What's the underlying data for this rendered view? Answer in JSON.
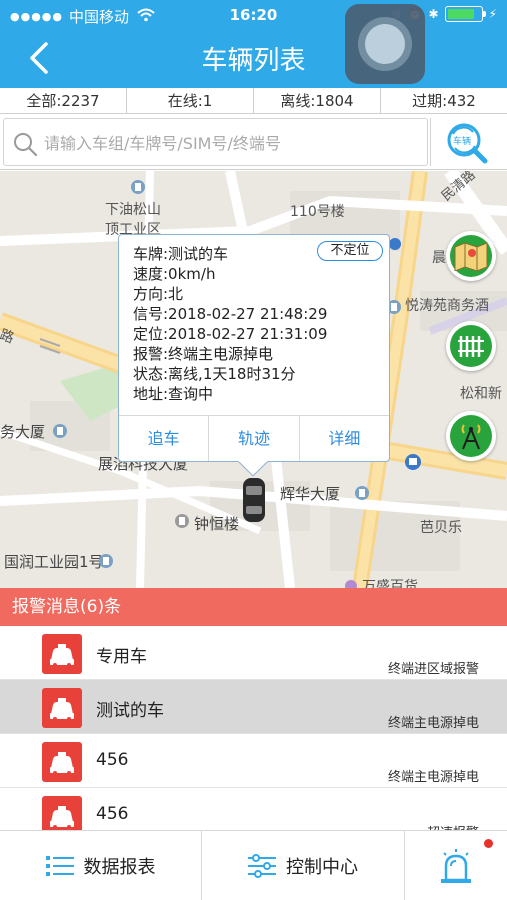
{
  "status_bar": {
    "carrier": "中国移动",
    "time": "16:20"
  },
  "nav": {
    "title": "车辆列表"
  },
  "stats": [
    {
      "label": "全部:2237"
    },
    {
      "label": "在线:1"
    },
    {
      "label": "离线:1804"
    },
    {
      "label": "过期:432"
    }
  ],
  "search": {
    "placeholder": "请输入车组/车牌号/SIM号/终端号",
    "button_label": "车辆"
  },
  "map": {
    "pois": [
      "下油松山",
      "顶工业区",
      "110号楼",
      "民清路",
      "晨",
      "悦涛苑商务酒",
      "松和新",
      "务大厦",
      "展滔科技大厦",
      "辉华大厦",
      "钟恒楼",
      "芭贝乐",
      "国润工业园1号",
      "万盛百货",
      "路"
    ]
  },
  "popup": {
    "plate": "车牌:测试的车",
    "speed": "速度:0km/h",
    "direction": "方向:北",
    "signal": "信号:2018-02-27 21:48:29",
    "position": "定位:2018-02-27 21:31:09",
    "alarm": "报警:终端主电源掉电",
    "state": "状态:离线,1天18时31分",
    "address": "地址:查询中",
    "badge": "不定位",
    "actions": [
      "追车",
      "轨迹",
      "详细"
    ]
  },
  "alarm": {
    "header": "报警消息(6)条",
    "items": [
      {
        "name": "专用车",
        "type": "终端进区域报警"
      },
      {
        "name": "测试的车",
        "type": "终端主电源掉电"
      },
      {
        "name": "456",
        "type": "终端主电源掉电"
      },
      {
        "name": "456",
        "type": "超速报警"
      }
    ]
  },
  "bottom_bar": {
    "report": "数据报表",
    "control": "控制中心"
  },
  "colors": {
    "header": "#2fa9e8",
    "alarm_header": "#f16a5f",
    "alarm_icon": "#e8413a",
    "map_tool": "#29a43d",
    "link": "#2f8de0"
  }
}
